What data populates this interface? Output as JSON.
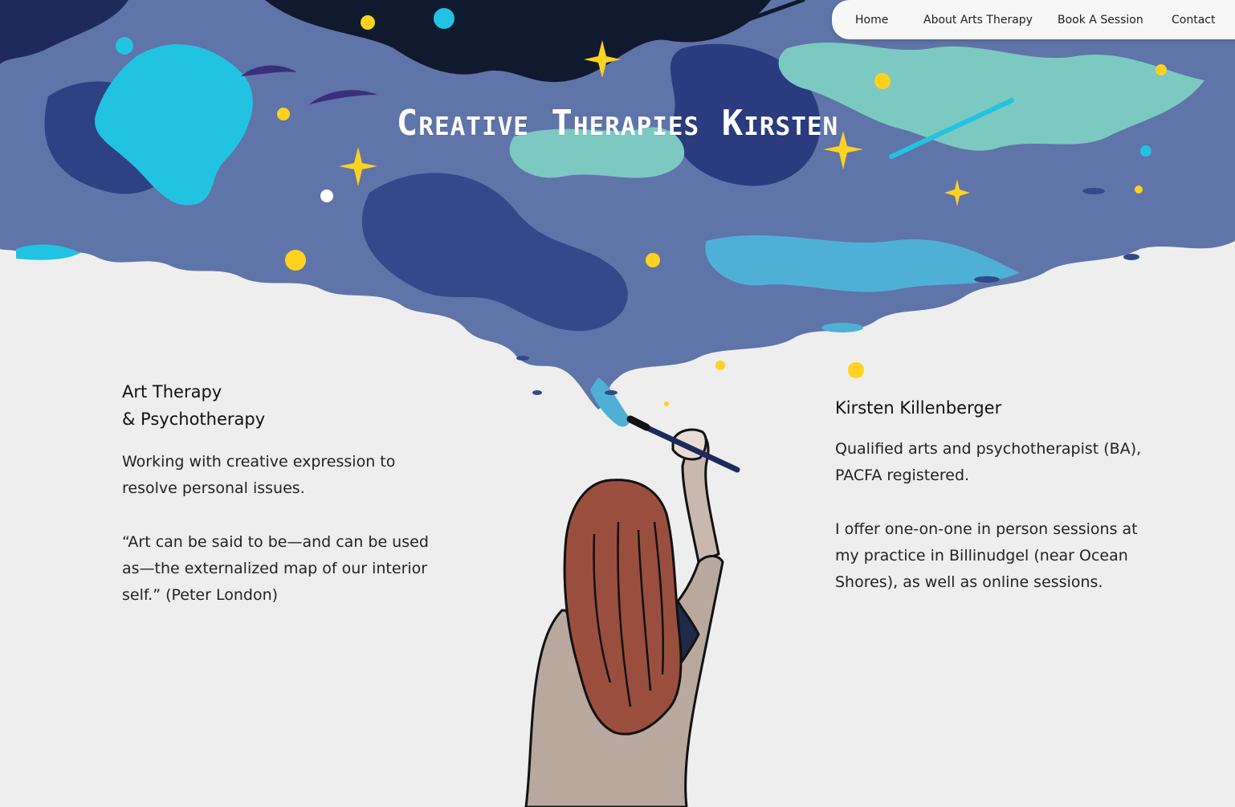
{
  "nav": {
    "items": [
      {
        "label": "Home"
      },
      {
        "label": "About Arts Therapy"
      },
      {
        "label": "Book A Session"
      },
      {
        "label": "Contact"
      }
    ]
  },
  "hero": {
    "title": "Creative Therapies Kirsten"
  },
  "left": {
    "heading_line1": "Art Therapy",
    "heading_line2": "& Psychotherapy",
    "para1": "Working with creative expression to resolve personal issues.",
    "para2": "“Art can be said to be—and can be used as—the externalized map of our interior self.” (Peter London)"
  },
  "right": {
    "heading": "Kirsten Killenberger",
    "para1": "Qualified arts and psychotherapist (BA), PACFA registered.",
    "para2": "I offer one-on-one in person sessions at my practice in Billinudgel (near Ocean Shores), as well as online sessions."
  },
  "colors": {
    "background": "#eeeeee",
    "sky_dark": "#0f1a2e",
    "sky_mid": "#3a4f8f",
    "sky_light": "#5f74a8",
    "teal": "#7cc9c2",
    "cyan": "#22c3e0",
    "star_yellow": "#ffd21f",
    "hair": "#9a4f3e",
    "shirt": "#b8a89e"
  }
}
